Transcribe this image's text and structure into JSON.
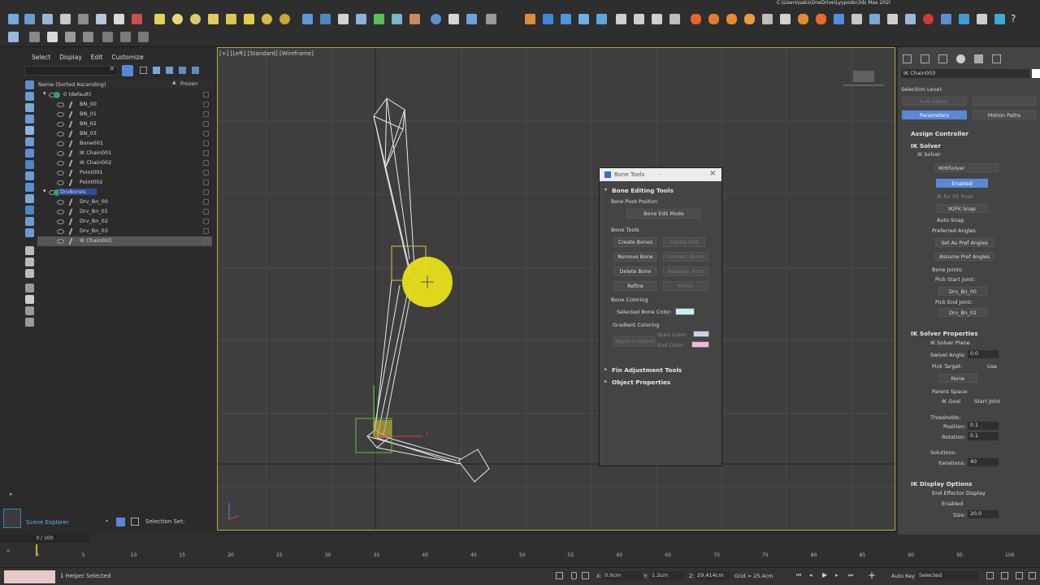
{
  "window": {
    "path": "C:\\Users\\saks\\OneDrive\\Lyypodo\\3ds Max 2020"
  },
  "menu": {
    "items": [
      "Select",
      "Display",
      "Edit",
      "Customize"
    ]
  },
  "viewport": {
    "label": "[+] [Left] [Standard] [Wireframe]"
  },
  "explorer": {
    "column_name": "Name (Sorted Ascending)",
    "column_frozen": "Frozen",
    "items": [
      {
        "label": "0 (default)",
        "level": 0
      },
      {
        "label": "BN_00",
        "level": 1
      },
      {
        "label": "BN_01",
        "level": 1
      },
      {
        "label": "BN_02",
        "level": 1
      },
      {
        "label": "BN_03",
        "level": 1
      },
      {
        "label": "Bone001",
        "level": 1
      },
      {
        "label": "IK Chain001",
        "level": 1
      },
      {
        "label": "IK Chain002",
        "level": 1
      },
      {
        "label": "Point001",
        "level": 1
      },
      {
        "label": "Point002",
        "level": 1
      },
      {
        "label": "DrvBones",
        "level": 0
      },
      {
        "label": "Drv_Bn_00",
        "level": 1
      },
      {
        "label": "Drv_Bn_01",
        "level": 1
      },
      {
        "label": "Drv_Bn_02",
        "level": 1
      },
      {
        "label": "Drv_Bn_03",
        "level": 1
      },
      {
        "label": "IK Chain003",
        "level": 1
      }
    ],
    "footer_tab": "Scene Explorer",
    "selection_set": "Selection Set:"
  },
  "bone_tools": {
    "title": "Bone Tools",
    "editing_header": "Bone Editing Tools",
    "pivot_label": "Bone Pivot Position",
    "edit_mode": "Bone Edit Mode",
    "tools_label": "Bone Tools",
    "create_bones": "Create Bones",
    "create_end": "Create End",
    "remove_bone": "Remove Bone",
    "connect_bones": "Connect Bones",
    "delete_bone": "Delete Bone",
    "reassign_root": "Reassign Root",
    "refine": "Refine",
    "mirror": "Mirror",
    "coloring_label": "Bone Coloring",
    "selected_color_label": "Selected Bone Color:",
    "gradient_label": "Gradient Coloring",
    "apply_gradient": "Apply Gradient",
    "start_color": "Start Color:",
    "end_color": "End Color:",
    "fin_header": "Fin Adjustment Tools",
    "object_header": "Object Properties",
    "colors": {
      "selected": "#c8eef2",
      "start": "#d0d0e8",
      "end": "#f2b8d8"
    }
  },
  "command_panel": {
    "object_name": "IK Chain003",
    "selection_level": "Selection Level:",
    "sub_object": "Sub-Object",
    "tab_parameters": "Parameters",
    "tab_motion_paths": "Motion Paths",
    "assign_controller": "Assign Controller",
    "ik_solver_header": "IK Solver",
    "ik_solver_label": "IK Solver",
    "solver_type": "IKHISolver",
    "enabled": "Enabled",
    "ik_for_fk": "IK for FK Pose",
    "ikfk_snap": "IK/FK Snap",
    "auto_snap": "Auto Snap",
    "preferred_angles": "Preferred Angles",
    "set_pref": "Set As Pref Angles",
    "assume_pref": "Assume Pref Angles",
    "bone_joints": "Bone Joints:",
    "pick_start": "Pick Start Joint:",
    "start_joint": "Drv_Bn_00",
    "pick_end": "Pick End Joint:",
    "end_joint": "Drv_Bn_02",
    "props_header": "IK Solver Properties",
    "solver_plane": "IK Solver Plane",
    "swivel_label": "Swivel Angle:",
    "swivel_value": "0.0",
    "pick_target": "Pick Target:",
    "use": "Use",
    "none": "None",
    "parent_space": "Parent Space:",
    "ik_goal": "IK Goal",
    "start_joint_opt": "Start Joint",
    "thresholds": "Thresholds:",
    "position_label": "Position:",
    "position_value": "0.1",
    "rotation_label": "Rotation:",
    "rotation_value": "0.1",
    "solutions": "Solutions:",
    "iterations_label": "Iterations:",
    "iterations_value": "40",
    "display_header": "IK Display Options",
    "end_effector": "End Effector Display",
    "enabled2": "Enabled",
    "size_label": "Size:",
    "size_value": "20.0"
  },
  "timeline": {
    "frame": "0 / 100",
    "ticks": [
      "0",
      "5",
      "10",
      "15",
      "20",
      "25",
      "30",
      "35",
      "40",
      "45",
      "50",
      "55",
      "60",
      "65",
      "70",
      "75",
      "80",
      "85",
      "90",
      "95",
      "100"
    ]
  },
  "status": {
    "selected": "1 Helper Selected",
    "x_label": "X:",
    "x_value": "0.0cm",
    "y_label": "Y:",
    "y_value": "1.2cm",
    "z_label": "Z:",
    "z_value": "29.414cm",
    "grid": "Grid = 25.4cm",
    "auto_key": "Auto Key",
    "selected_dropdown": "Selected"
  }
}
